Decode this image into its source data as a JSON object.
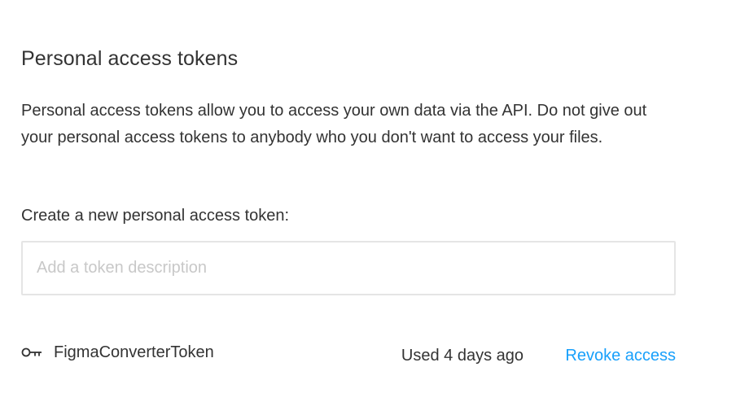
{
  "section": {
    "title": "Personal access tokens",
    "description": "Personal access tokens allow you to access your own data via the API. Do not give out your personal access tokens to anybody who you don't want to access your files."
  },
  "create": {
    "label": "Create a new personal access token:",
    "input_placeholder": "Add a token description",
    "input_value": ""
  },
  "tokens": [
    {
      "icon": "key-icon",
      "name": "FigmaConverterToken",
      "last_used": "Used 4 days ago",
      "revoke_label": "Revoke access"
    }
  ],
  "colors": {
    "text": "#333333",
    "link": "#18a0fb",
    "placeholder": "#c8c8c8",
    "input_border": "#e5e5e5"
  }
}
